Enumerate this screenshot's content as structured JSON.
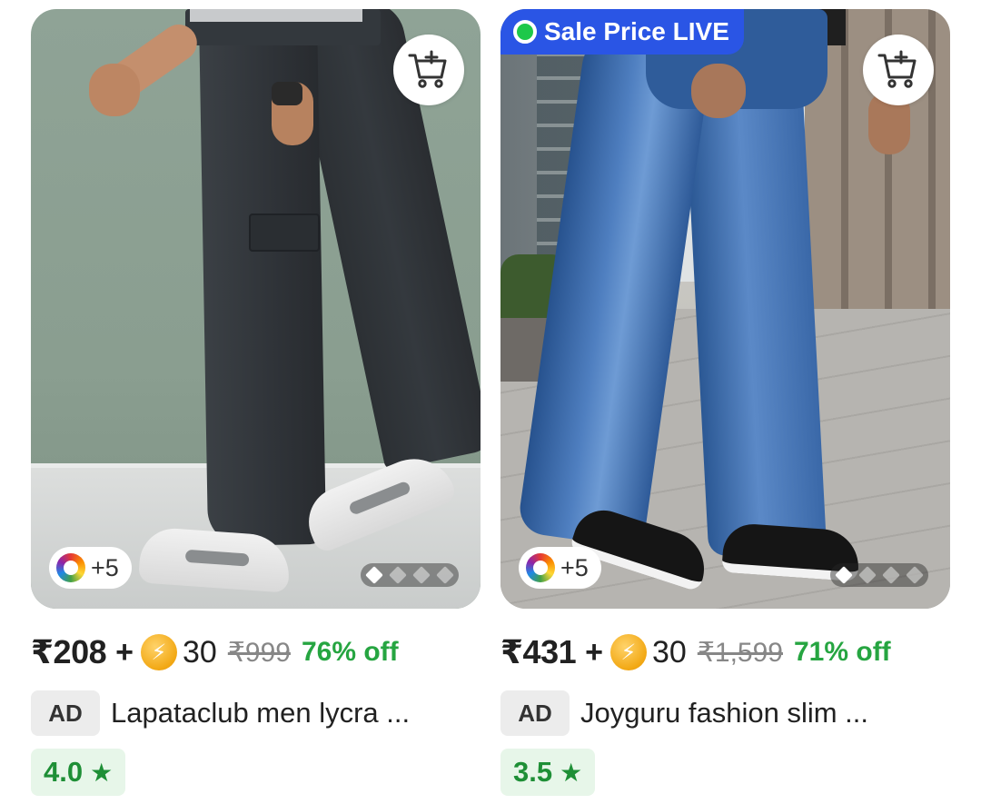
{
  "products": [
    {
      "badge": "",
      "variants": "+5",
      "price": "₹208",
      "coins": "30",
      "mrp": "₹999",
      "discount": "76% off",
      "ad_label": "AD",
      "name": "Lapataclub men lycra ...",
      "rating": "4.0",
      "star": "★",
      "image_count": 4,
      "active_image": 1
    },
    {
      "badge": "Sale Price LIVE",
      "variants": "+5",
      "price": "₹431",
      "coins": "30",
      "mrp": "₹1,599",
      "discount": "71% off",
      "ad_label": "AD",
      "name": "Joyguru fashion slim ...",
      "rating": "3.5",
      "star": "★",
      "image_count": 4,
      "active_image": 1
    }
  ],
  "common": {
    "plus": "+",
    "coin_glyph": "⚡"
  },
  "colors": {
    "discount_green": "#26a541",
    "rating_green": "#1e8f36",
    "badge_blue": "#2a55e5"
  },
  "icons": {
    "cart": "add-to-cart-icon",
    "swatch": "color-variants-icon",
    "coin": "supercoin-icon"
  }
}
